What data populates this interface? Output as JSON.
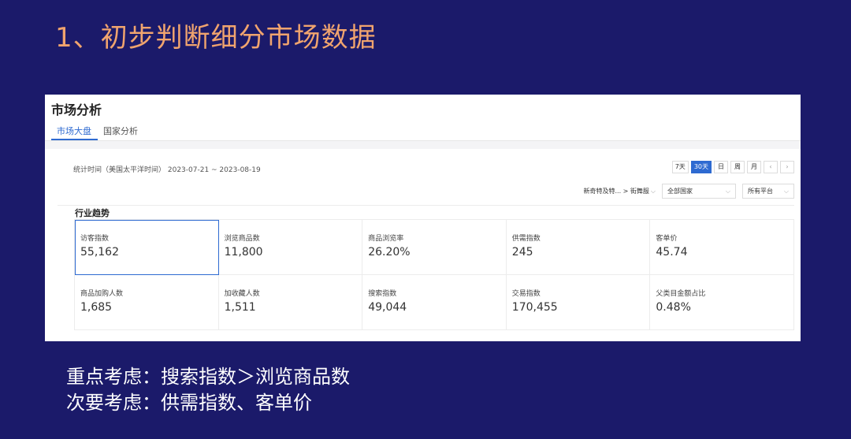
{
  "slide": {
    "title": "1、初步判断细分市场数据",
    "notes": [
      "重点考虑：搜索指数＞浏览商品数",
      "次要考虑：供需指数、客单价"
    ]
  },
  "screenshot": {
    "title": "市场分析",
    "tabs": [
      {
        "label": "市场大盘",
        "active": true
      },
      {
        "label": "国家分析",
        "active": false
      }
    ],
    "date_range": "统计时间（美国太平洋时间） 2023-07-21 ~ 2023-08-19",
    "period_buttons": [
      {
        "label": "7天",
        "active": false
      },
      {
        "label": "30天",
        "active": true
      },
      {
        "label": "日",
        "active": false
      },
      {
        "label": "周",
        "active": false
      },
      {
        "label": "月",
        "active": false
      }
    ],
    "prev_icon": "chevron-left-icon",
    "next_icon": "chevron-right-icon",
    "category_path": "新奇特及特... > 街舞服",
    "country_select": "全部国家",
    "platform_select": "所有平台",
    "section_title": "行业趋势",
    "metrics": [
      {
        "label": "访客指数",
        "value": "55,162",
        "selected": true
      },
      {
        "label": "浏览商品数",
        "value": "11,800"
      },
      {
        "label": "商品浏览率",
        "value": "26.20%"
      },
      {
        "label": "供需指数",
        "value": "245"
      },
      {
        "label": "客单价",
        "value": "45.74"
      },
      {
        "label": "商品加购人数",
        "value": "1,685"
      },
      {
        "label": "加收藏人数",
        "value": "1,511"
      },
      {
        "label": "搜索指数",
        "value": "49,044"
      },
      {
        "label": "交易指数",
        "value": "170,455"
      },
      {
        "label": "父类目金额占比",
        "value": "0.48%"
      }
    ],
    "colors": {
      "accent": "#2e6ad1",
      "slide_bg": "#1b1a6a",
      "title": "#f0a46e"
    }
  }
}
